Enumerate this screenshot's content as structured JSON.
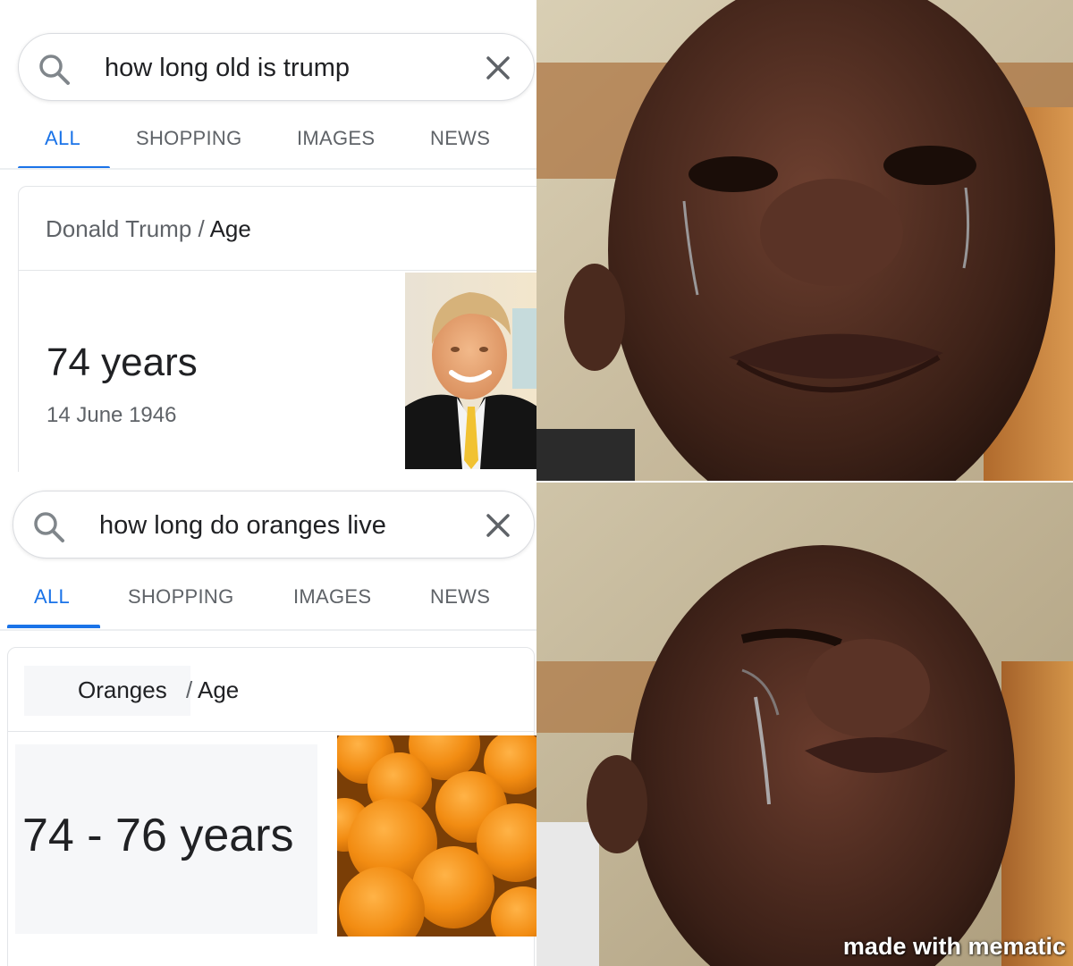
{
  "top_search": {
    "query": "how long old is trump",
    "tabs": [
      "ALL",
      "SHOPPING",
      "IMAGES",
      "NEWS"
    ],
    "active_tab": "ALL",
    "card": {
      "entity": "Donald Trump",
      "separator": "/",
      "attribute": "Age",
      "answer": "74 years",
      "subtext": "14 June 1946"
    }
  },
  "bottom_search": {
    "query": "how long do oranges live",
    "tabs": [
      "ALL",
      "SHOPPING",
      "IMAGES",
      "NEWS"
    ],
    "active_tab": "ALL",
    "card": {
      "entity": "Oranges",
      "separator": "/",
      "attribute": "Age",
      "answer": "74 - 76 years"
    }
  },
  "watermark": "made with mematic",
  "colors": {
    "accent": "#1a73e8",
    "text_primary": "#202124",
    "text_secondary": "#5f6368",
    "border": "#dadce0"
  },
  "icons": {
    "search": "search-icon",
    "clear": "close-icon"
  }
}
